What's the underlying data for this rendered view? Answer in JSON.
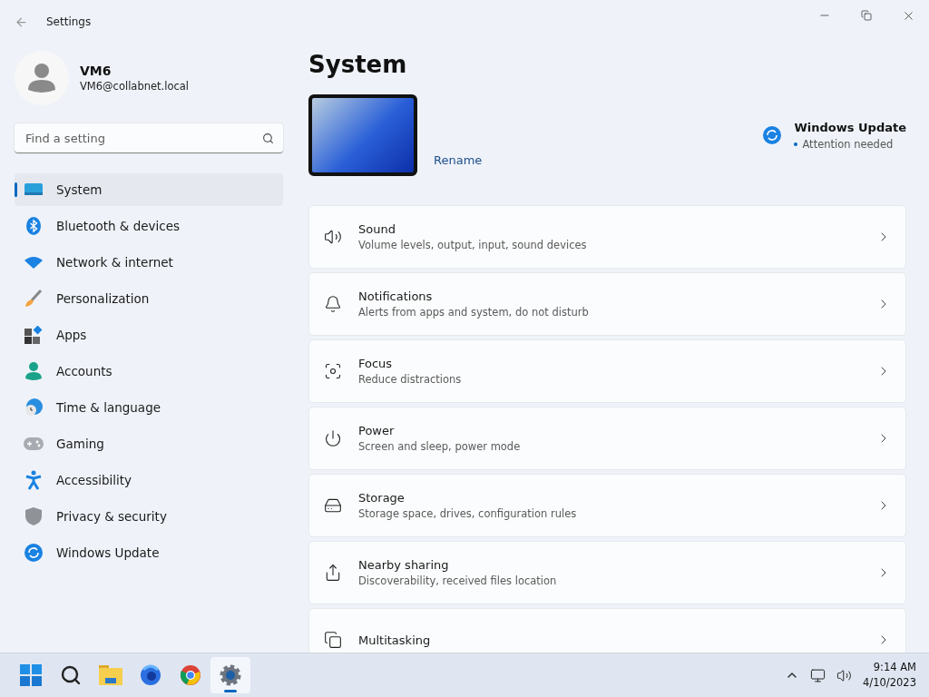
{
  "window": {
    "title": "Settings"
  },
  "account": {
    "name": "VM6",
    "email": "VM6@collabnet.local"
  },
  "search": {
    "placeholder": "Find a setting"
  },
  "sidebar": {
    "items": [
      {
        "label": "System",
        "selected": true
      },
      {
        "label": "Bluetooth & devices",
        "selected": false
      },
      {
        "label": "Network & internet",
        "selected": false
      },
      {
        "label": "Personalization",
        "selected": false
      },
      {
        "label": "Apps",
        "selected": false
      },
      {
        "label": "Accounts",
        "selected": false
      },
      {
        "label": "Time & language",
        "selected": false
      },
      {
        "label": "Gaming",
        "selected": false
      },
      {
        "label": "Accessibility",
        "selected": false
      },
      {
        "label": "Privacy & security",
        "selected": false
      },
      {
        "label": "Windows Update",
        "selected": false
      }
    ]
  },
  "page": {
    "title": "System",
    "rename": "Rename",
    "update": {
      "title": "Windows Update",
      "status": "Attention needed"
    }
  },
  "cards": [
    {
      "title": "Sound",
      "subtitle": "Volume levels, output, input, sound devices"
    },
    {
      "title": "Notifications",
      "subtitle": "Alerts from apps and system, do not disturb"
    },
    {
      "title": "Focus",
      "subtitle": "Reduce distractions"
    },
    {
      "title": "Power",
      "subtitle": "Screen and sleep, power mode"
    },
    {
      "title": "Storage",
      "subtitle": "Storage space, drives, configuration rules"
    },
    {
      "title": "Nearby sharing",
      "subtitle": "Discoverability, received files location"
    },
    {
      "title": "Multitasking"
    }
  ],
  "taskbar": {
    "items": [
      {
        "selected": false
      },
      {
        "selected": false
      },
      {
        "selected": false
      },
      {
        "selected": false
      },
      {
        "selected": false
      },
      {
        "selected": true
      }
    ],
    "time": "9:14 AM",
    "date": "4/10/2023"
  }
}
